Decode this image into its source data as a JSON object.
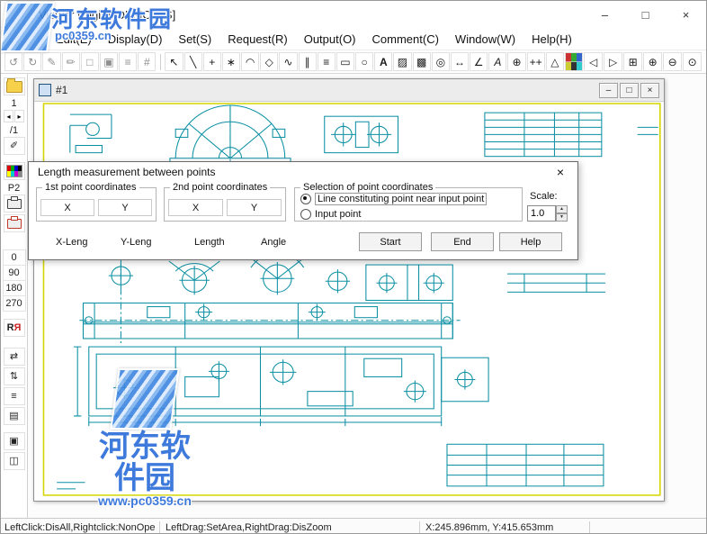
{
  "watermark": {
    "site_name": "河东软件园",
    "site_url": "www.pc0359.cn",
    "short_url": "pc0359.cn"
  },
  "titlebar": {
    "title": "Viewer [Digital DEMO-JIS]",
    "minimize": "–",
    "maximize": "□",
    "close": "×"
  },
  "menu": {
    "items": [
      {
        "label": "Edit(E)"
      },
      {
        "label": "Display(D)"
      },
      {
        "label": "Set(S)"
      },
      {
        "label": "Request(R)"
      },
      {
        "label": "Output(O)"
      },
      {
        "label": "Comment(C)"
      },
      {
        "label": "Window(W)"
      },
      {
        "label": "Help(H)"
      }
    ]
  },
  "toolbar": {
    "left": [
      {
        "name": "undo-icon",
        "glyph": "↺"
      },
      {
        "name": "redo-icon",
        "glyph": "↻"
      },
      {
        "name": "pen-icon",
        "glyph": "✎"
      },
      {
        "name": "pencil-icon",
        "glyph": "✏"
      },
      {
        "name": "doc-icon",
        "glyph": "□"
      },
      {
        "name": "copy-icon",
        "glyph": "▣"
      },
      {
        "name": "list-icon",
        "glyph": "≡"
      },
      {
        "name": "hash-icon",
        "glyph": "#"
      }
    ],
    "main": [
      {
        "name": "select-tool-icon",
        "glyph": "↖"
      },
      {
        "name": "line-tool-icon",
        "glyph": "╲"
      },
      {
        "name": "point-tool-icon",
        "glyph": "+"
      },
      {
        "name": "star-tool-icon",
        "glyph": "∗"
      },
      {
        "name": "arc-tool-icon",
        "glyph": "◠"
      },
      {
        "name": "polygon-tool-icon",
        "glyph": "◇"
      },
      {
        "name": "spline-tool-icon",
        "glyph": "∿"
      },
      {
        "name": "parallel-tool-icon",
        "glyph": "∥"
      },
      {
        "name": "hatch-lines-tool-icon",
        "glyph": "≡"
      },
      {
        "name": "rectangle-tool-icon",
        "glyph": "▭"
      },
      {
        "name": "ellipse-tool-icon",
        "glyph": "○"
      },
      {
        "name": "text-tool-icon",
        "glyph": "A"
      },
      {
        "name": "hatch-fill-tool-icon",
        "glyph": "▨"
      },
      {
        "name": "dot-grid-tool-icon",
        "glyph": "▩"
      },
      {
        "name": "symbol-tool-icon",
        "glyph": "◎"
      },
      {
        "name": "dimension-tool-icon",
        "glyph": "↔"
      },
      {
        "name": "angle-tool-icon",
        "glyph": "∠"
      },
      {
        "name": "italic-text-tool-icon",
        "glyph": "A"
      },
      {
        "name": "center-mark-tool-icon",
        "glyph": "⊕"
      },
      {
        "name": "dim-plus-tool-icon",
        "glyph": "++"
      },
      {
        "name": "angle-dim-tool-icon",
        "glyph": "△"
      },
      {
        "name": "color-grid-tool-icon",
        "glyph": ""
      }
    ],
    "right": [
      {
        "name": "prev-view-icon",
        "glyph": "◁"
      },
      {
        "name": "next-view-icon",
        "glyph": "▷"
      },
      {
        "name": "zoom-window-icon",
        "glyph": "⊞"
      },
      {
        "name": "zoom-in-icon",
        "glyph": "⊕"
      },
      {
        "name": "zoom-out-icon",
        "glyph": "⊖"
      },
      {
        "name": "zoom-full-icon",
        "glyph": "⊙"
      }
    ]
  },
  "sidebar": {
    "page_current": "1",
    "page_total": "/1",
    "prev_glyph": "◂",
    "next_glyph": "▸",
    "edit_glyph": "✐",
    "layer_label": "P2",
    "angles": [
      "0",
      "90",
      "180",
      "270"
    ],
    "mirror": {
      "left": "R",
      "right": "Я"
    },
    "pan_glyph": "⇄",
    "fit_glyph": "⇅",
    "list_glyph": "≡",
    "grid_glyph": "▤",
    "window_glyph": "▣",
    "screen_glyph": "◫"
  },
  "child_window": {
    "title": "#1",
    "minimize": "–",
    "restore": "□",
    "close": "×"
  },
  "dialog": {
    "title": "Length measurement between points",
    "close": "×",
    "group1": {
      "title": "1st point coordinates",
      "x": "X",
      "y": "Y"
    },
    "group2": {
      "title": "2nd point coordinates",
      "x": "X",
      "y": "Y"
    },
    "group3": {
      "title": "Selection of point coordinates",
      "option1": "Line constituting point near input point",
      "option2": "Input point"
    },
    "scale": {
      "label": "Scale:",
      "value": "1.0"
    },
    "results": [
      {
        "label": "X-Leng"
      },
      {
        "label": "Y-Leng"
      },
      {
        "label": "Length"
      },
      {
        "label": "Angle"
      }
    ],
    "buttons": [
      {
        "label": "Start"
      },
      {
        "label": "End"
      },
      {
        "label": "Help"
      }
    ]
  },
  "statusbar": {
    "left": "LeftClick:DisAll,Rightclick:NonOpe",
    "middle": "LeftDrag:SetArea,RightDrag:DisZoom",
    "coords": "X:245.896mm, Y:415.653mm"
  },
  "colors": {
    "cad_line": "#0b8fa3",
    "frame_yellow": "#d4d400",
    "watermark_blue": "#2e6fd8"
  }
}
